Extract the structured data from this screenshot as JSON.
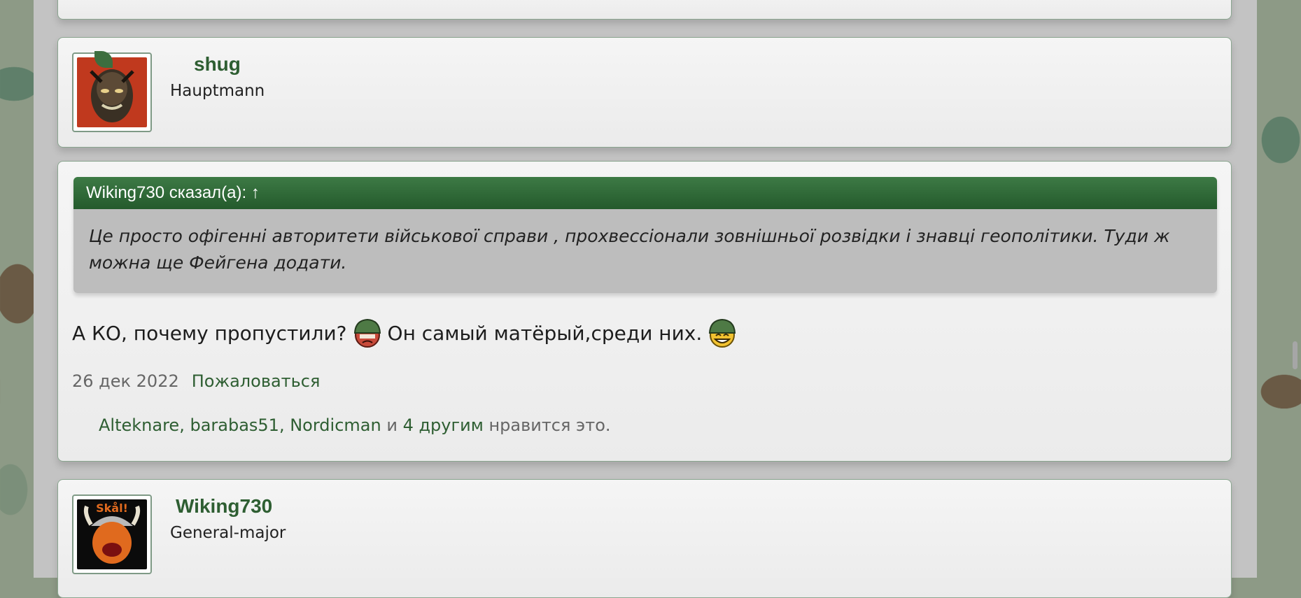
{
  "post_top": {},
  "post_shug": {
    "username": "shug",
    "user_title": "Hauptmann"
  },
  "post_main": {
    "quote_author_line": "Wiking730 сказал(а): ↑",
    "quote_text": "Це просто офігенні авторитети військової справи , прохвессіонали зовнішньої розвідки і знавці геополітики. Туди ж можна ще Фейгена додати.",
    "text_part1": "А КО, почему пропустили?",
    "text_part2": "Он самый матёрый,среди них.",
    "date": "26 дек 2022",
    "report_label": "Пожаловаться",
    "likes": {
      "user1": "Alteknare",
      "sep1": ", ",
      "user2": "barabas51",
      "sep2": ", ",
      "user3": "Nordicman",
      "and": " и ",
      "others": "4 другим",
      "suffix": " нравится это."
    }
  },
  "post_wiking": {
    "username": "Wiking730",
    "user_title": "General-major"
  },
  "icons": {
    "smiley1": "soldier-sad-smiley-icon",
    "smiley2": "soldier-laugh-smiley-icon"
  },
  "colors": {
    "accent_green": "#2e5e32",
    "quote_header": "#2f6b38"
  }
}
